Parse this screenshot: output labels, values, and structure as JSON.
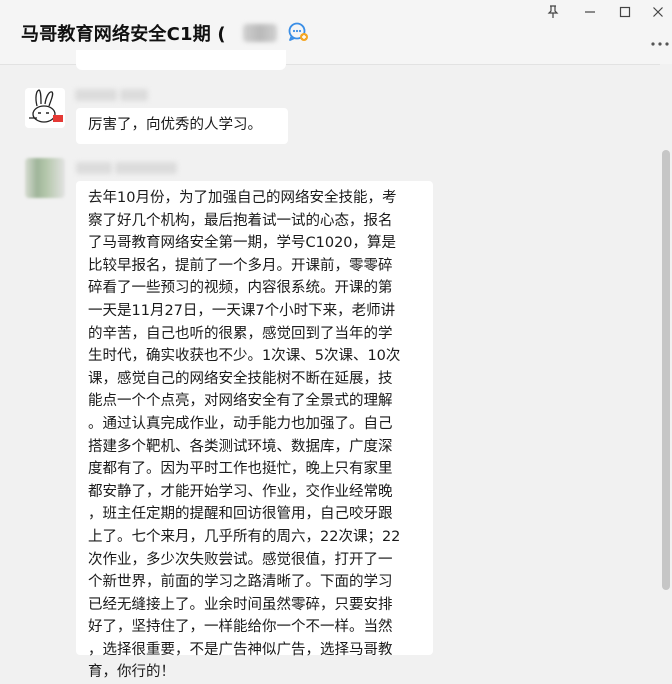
{
  "chat": {
    "title": "马哥教育网络安全C1期 (",
    "title_icon": "group-chat-add-icon"
  },
  "window_controls": {
    "pin": "pin-icon",
    "minimize": "minimize-icon",
    "maximize": "maximize-icon",
    "close": "close-icon",
    "more": "more-icon"
  },
  "messages": [
    {
      "avatar": "cartoon-rabbit-avatar",
      "text": "厉害了，向优秀的人学习。"
    },
    {
      "avatar": "blurred-avatar",
      "lines": [
        "去年10月份，为了加强自己的网络安全技能，考",
        "察了好几个机构，最后抱着试一试的心态，报名",
        "了马哥教育网络安全第一期，学号C1020，算是",
        "比较早报名，提前了一个多月。开课前，零零碎",
        "碎看了一些预习的视频，内容很系统。开课的第",
        "一天是11月27日，一天课7个小时下来，老师讲",
        "的辛苦，自己也听的很累，感觉回到了当年的学",
        "生时代，确实收获也不少。1次课、5次课、10次",
        "课，感觉自己的网络安全技能树不断在延展，技",
        "能点一个个点亮，对网络安全有了全景式的理解",
        "。通过认真完成作业，动手能力也加强了。自己",
        "搭建多个靶机、各类测试环境、数据库，广度深",
        "度都有了。因为平时工作也挺忙，晚上只有家里",
        "都安静了，才能开始学习、作业，交作业经常晚",
        "，班主任定期的提醒和回访很管用，自己咬牙跟",
        "上了。七个来月，几乎所有的周六，22次课；22",
        "次作业，多少次失败尝试。感觉很值，打开了一",
        "个新世界，前面的学习之路清晰了。下面的学习",
        "已经无缝接上了。业余时间虽然零碎，只要安排",
        "好了，坚持住了，一样能给你一个不一样。当然",
        "，选择很重要，不是广告神似广告，选择马哥教",
        "育，你行的！"
      ]
    }
  ]
}
